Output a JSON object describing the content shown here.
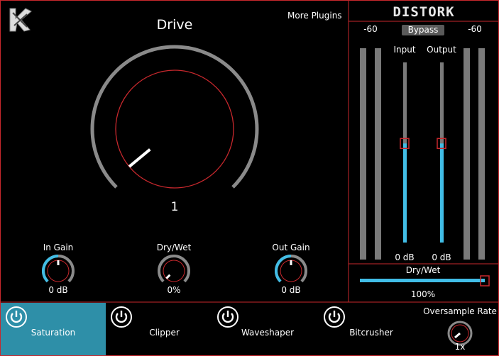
{
  "header": {
    "more_plugins": "More Plugins",
    "product_name": "DISTORK",
    "logo_icon": "stylized-k-logo"
  },
  "drive": {
    "label": "Drive",
    "value": "1",
    "level": 0.02
  },
  "small_knobs": [
    {
      "label": "In Gain",
      "value": "0 dB",
      "level": 0.5
    },
    {
      "label": "Dry/Wet",
      "value": "0%",
      "level": 0.0
    },
    {
      "label": "Out Gain",
      "value": "0 dB",
      "level": 0.5
    }
  ],
  "meters": {
    "left_peak": "-60",
    "right_peak": "-60",
    "bypass": "Bypass",
    "input_label": "Input",
    "output_label": "Output",
    "input_value": "0 dB",
    "output_value": "0 dB",
    "input_level": 0.55,
    "output_level": 0.55
  },
  "drywet_slider": {
    "label": "Dry/Wet",
    "value": "100%",
    "level": 1.0
  },
  "modes": [
    {
      "label": "Saturation",
      "active": true
    },
    {
      "label": "Clipper",
      "active": false
    },
    {
      "label": "Waveshaper",
      "active": false
    },
    {
      "label": "Bitcrusher",
      "active": false
    }
  ],
  "oversample": {
    "label": "Oversample Rate",
    "value": "1x"
  },
  "colors": {
    "accent": "#41bde6",
    "red": "#c8282d",
    "knob_track": "#8a8a8a",
    "active_tab": "#2e8fa8"
  }
}
